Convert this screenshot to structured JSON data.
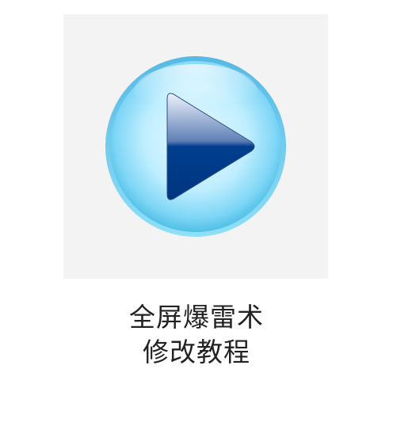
{
  "caption": {
    "line1": "全屏爆雷术",
    "line2": "修改教程"
  },
  "play_button": {
    "icon": "play-icon",
    "ring_color": "#7fd6f6",
    "triangle_color": "#003e8e"
  }
}
